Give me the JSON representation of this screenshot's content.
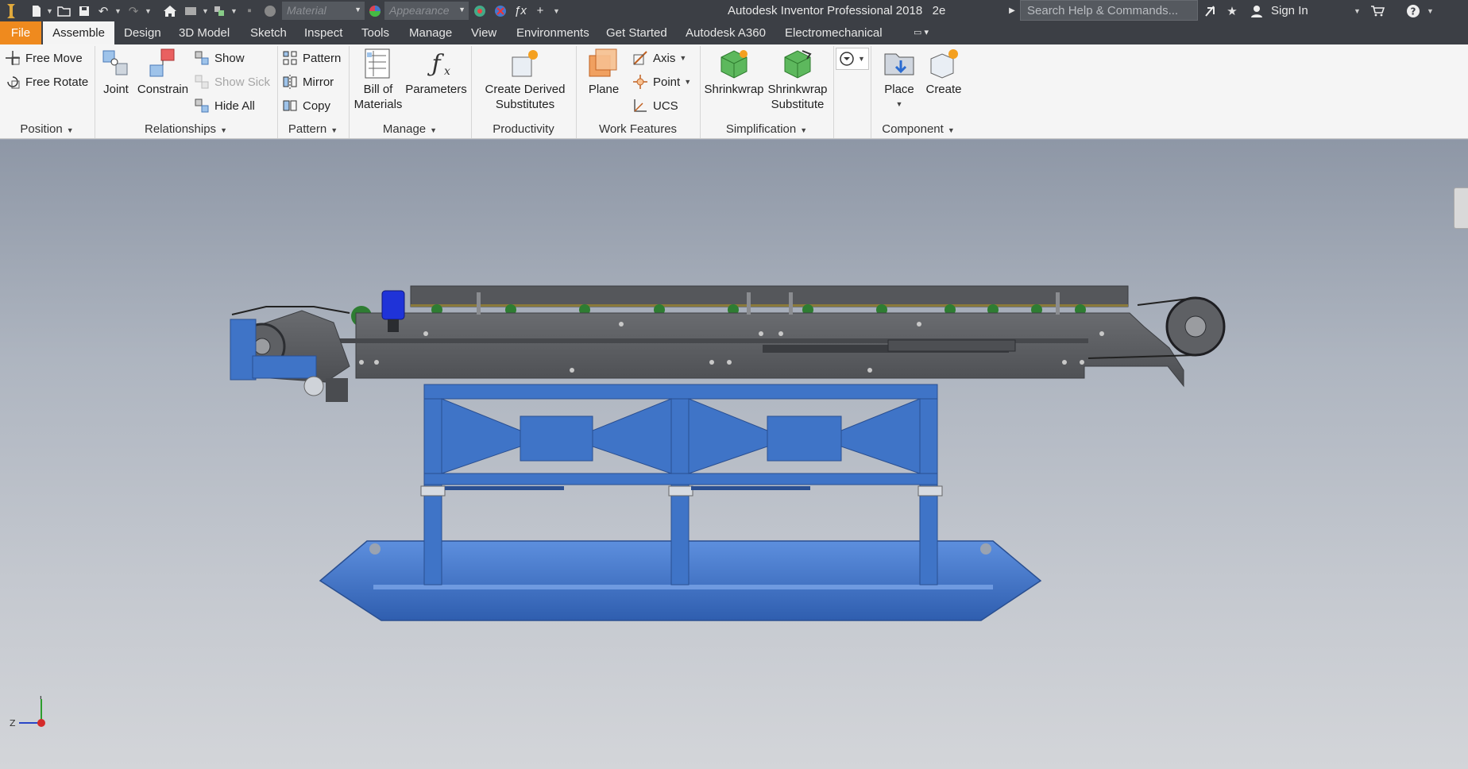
{
  "title_bar": {
    "material_placeholder": "Material",
    "appearance_placeholder": "Appearance",
    "app_title": "Autodesk Inventor Professional 2018",
    "document_name": "2e",
    "search_placeholder": "Search Help & Commands...",
    "sign_in": "Sign In"
  },
  "tabs": [
    "File",
    "Assemble",
    "Design",
    "3D Model",
    "Sketch",
    "Inspect",
    "Tools",
    "Manage",
    "View",
    "Environments",
    "Get Started",
    "Autodesk A360",
    "Electromechanical"
  ],
  "active_tab": "Assemble",
  "ribbon": {
    "position": {
      "free_move": "Free Move",
      "free_rotate": "Free Rotate",
      "label": "Position"
    },
    "relationships": {
      "joint": "Joint",
      "constrain": "Constrain",
      "show": "Show",
      "show_sick": "Show Sick",
      "hide_all": "Hide All",
      "label": "Relationships"
    },
    "pattern": {
      "pattern": "Pattern",
      "mirror": "Mirror",
      "copy": "Copy",
      "label": "Pattern"
    },
    "manage": {
      "bom_line1": "Bill of",
      "bom_line2": "Materials",
      "parameters": "Parameters",
      "label": "Manage"
    },
    "productivity": {
      "derived_line1": "Create Derived",
      "derived_line2": "Substitutes",
      "label": "Productivity"
    },
    "work_features": {
      "plane": "Plane",
      "axis": "Axis",
      "point": "Point",
      "ucs": "UCS",
      "label": "Work Features"
    },
    "simplification": {
      "shrinkwrap": "Shrinkwrap",
      "shrinkwrap_sub_line1": "Shrinkwrap",
      "shrinkwrap_sub_line2": "Substitute",
      "label": "Simplification"
    },
    "component": {
      "place": "Place",
      "create": "Create",
      "label": "Component"
    }
  },
  "viewport": {
    "triad": {
      "y": "Y",
      "z": "Z"
    }
  },
  "colors": {
    "accent_file": "#ef8a1e",
    "title_bg": "#3c3f45",
    "frame_blue": "#3f74c7",
    "belt_gray": "#5a5c60"
  }
}
